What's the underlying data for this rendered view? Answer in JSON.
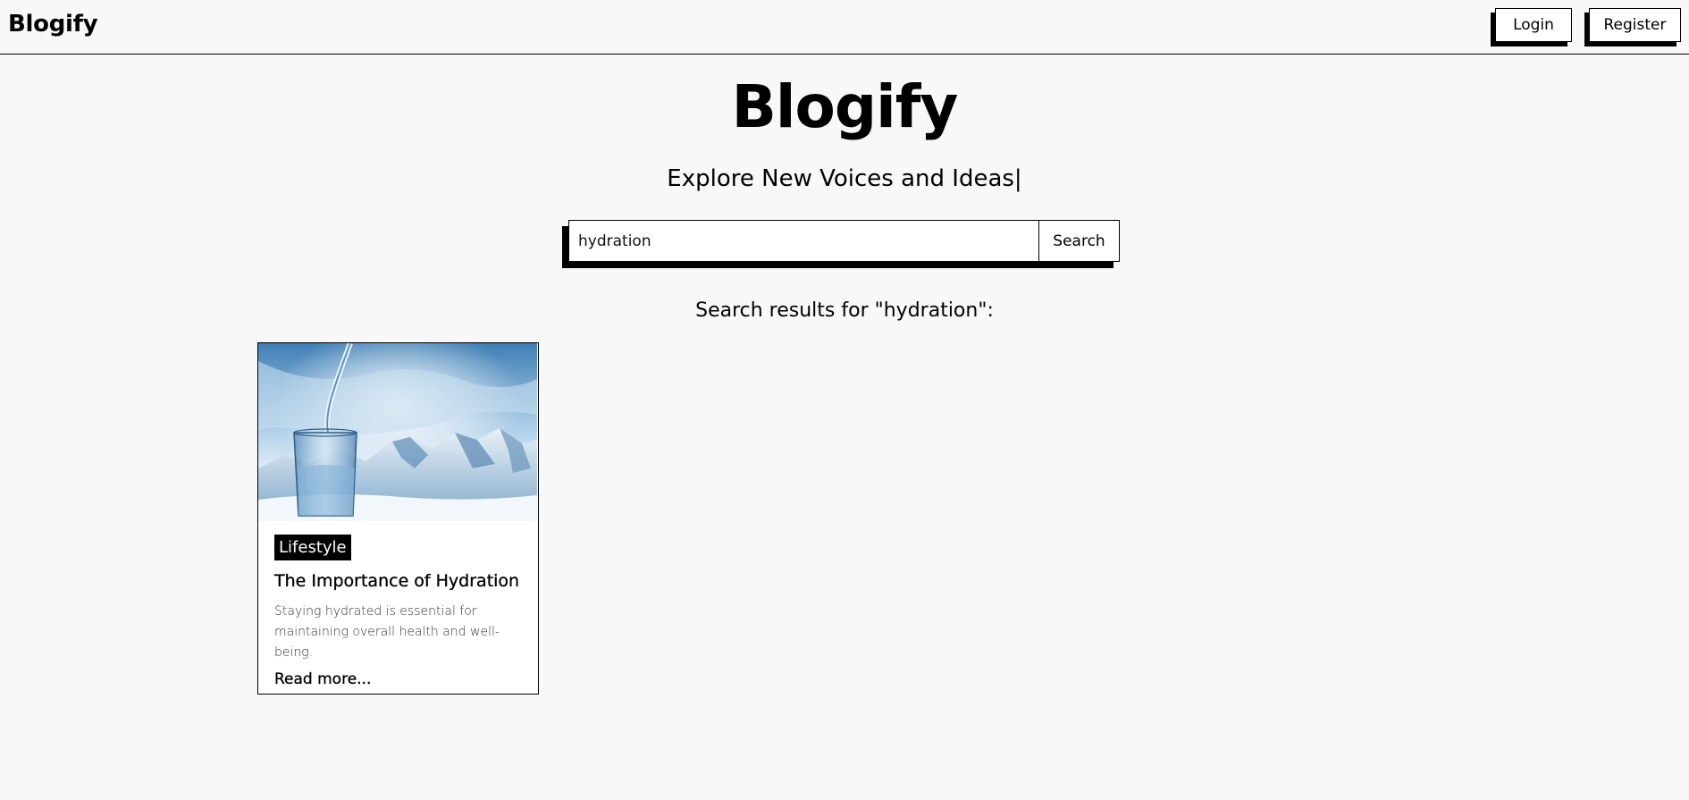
{
  "navbar": {
    "brand": "Blogify",
    "login_label": "Login",
    "register_label": "Register"
  },
  "hero": {
    "title": "Blogify",
    "subtitle": "Explore New Voices and Ideas|"
  },
  "search": {
    "value": "hydration",
    "button_label": "Search"
  },
  "results": {
    "heading": "Search results for \"hydration\":",
    "posts": [
      {
        "image": "glass-of-water-mountains-image",
        "tag": "Lifestyle",
        "title": "The Importance of Hydration",
        "description": "Staying hydrated is essential for maintaining overall health and well-being.",
        "link_label": "Read more..."
      }
    ]
  },
  "colors": {
    "background": "#f8f8f8",
    "ink": "#000000",
    "card": "#ffffff"
  }
}
